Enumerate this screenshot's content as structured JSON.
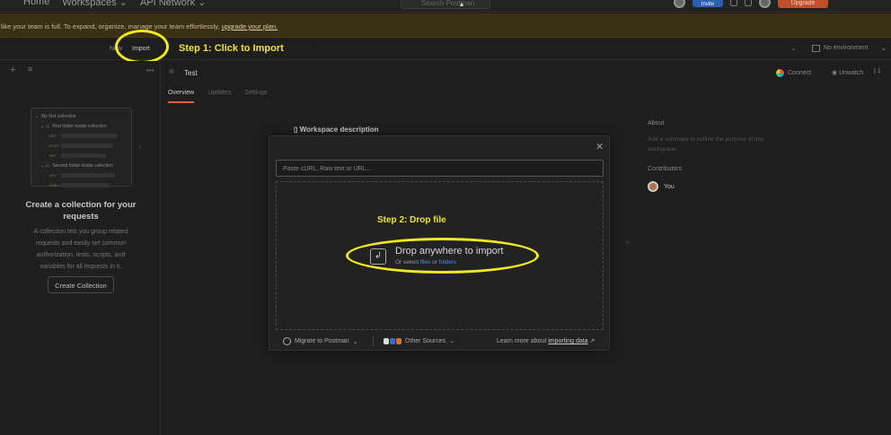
{
  "topbar": {
    "nav": [
      "Home",
      "Workspaces ⌄",
      "API Network ⌄"
    ],
    "search_placeholder": "Search Postman",
    "invite_label": "Invite",
    "upgrade_label": "Upgrade"
  },
  "banner": {
    "text": "like your team is full. To expand, organize, manage your team effortlessly, ",
    "link": "upgrade your plan."
  },
  "toolbar": {
    "new_label": "New",
    "import_label": "Import",
    "step1": "Step 1: Click to Import",
    "environment": "No environment"
  },
  "sidebar": {
    "preview": {
      "collection": "My first collection",
      "folder1": "First folder inside collection",
      "folder2": "Second folder inside collection",
      "tag_get": "GET",
      "tag_post": "POST"
    },
    "title": "Create a collection for your requests",
    "description": "A collection lets you group related requests and easily set common authorization, tests, scripts, and variables for all requests in it.",
    "create_button": "Create Collection"
  },
  "workspace": {
    "name": "Test",
    "connect": "Connect",
    "unwatch": "Unwatch",
    "watch_count": "1",
    "tabs": [
      {
        "label": "Overview"
      },
      {
        "label": "Updates"
      },
      {
        "label": "Settings"
      }
    ],
    "description_label": "Workspace description",
    "about_title": "About",
    "about_text": "Add a summary to outline the purpose of this workspace.",
    "contributors_title": "Contributors",
    "contributor": "You"
  },
  "modal": {
    "url_placeholder": "Paste cURL, Raw text or URL...",
    "step2": "Step 2: Drop file",
    "drop_title": "Drop anywhere to import",
    "drop_or_select": "Or select",
    "files_link": "files",
    "or": "or",
    "folders_link": "folders",
    "migrate": "Migrate to Postman",
    "other_sources": "Other Sources",
    "learn_more": "Learn more about",
    "importing_data": "importing data",
    "accent_link_color": "#4c8ee8",
    "highlight_color": "#f2ea1f"
  }
}
